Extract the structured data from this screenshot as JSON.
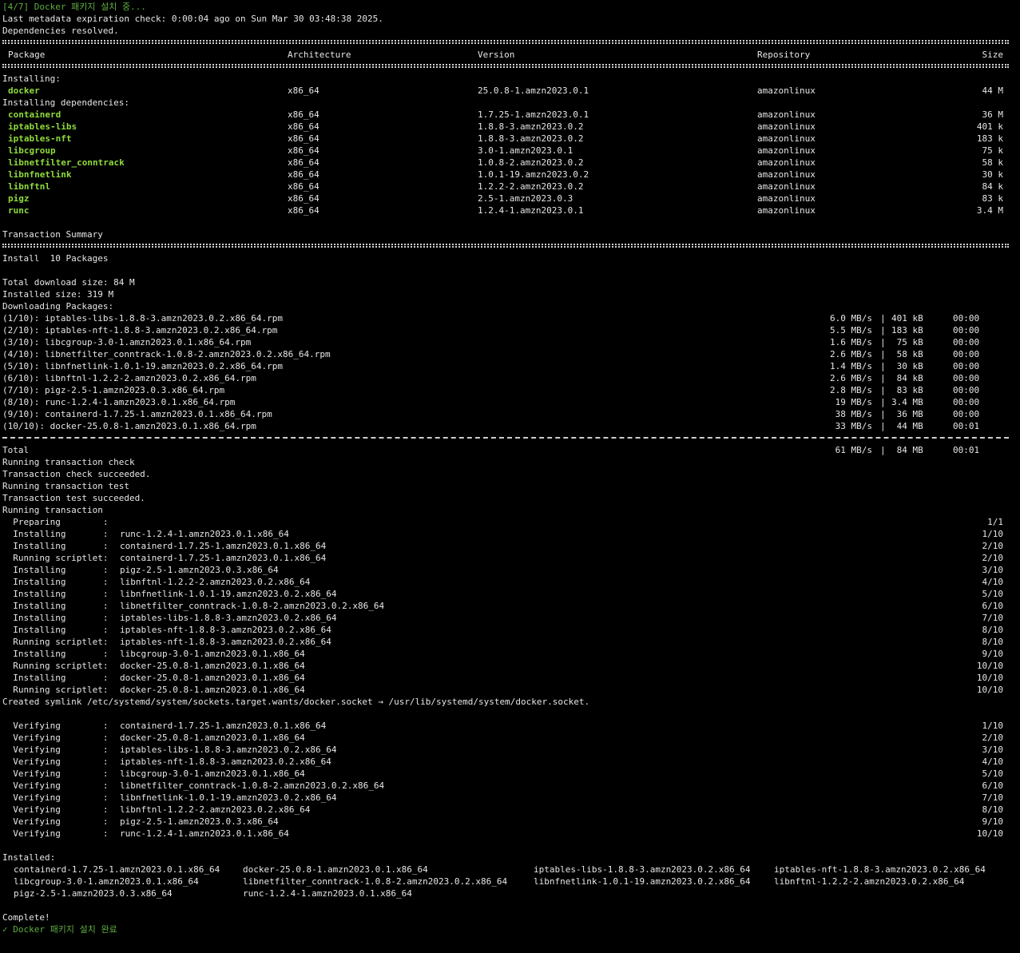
{
  "header": {
    "status_start": "[4/7] Docker 패키지 설치 중...",
    "metadata": "Last metadata expiration check: 0:00:04 ago on Sun Mar 30 03:48:38 2025.",
    "deps_resolved": "Dependencies resolved."
  },
  "table": {
    "columns": [
      "Package",
      "Architecture",
      "Version",
      "Repository",
      "Size"
    ],
    "installing_label": "Installing:",
    "installing": [
      {
        "name": "docker",
        "arch": "x86_64",
        "version": "25.0.8-1.amzn2023.0.1",
        "repo": "amazonlinux",
        "size": "44 M"
      }
    ],
    "deps_label": "Installing dependencies:",
    "deps": [
      {
        "name": "containerd",
        "arch": "x86_64",
        "version": "1.7.25-1.amzn2023.0.1",
        "repo": "amazonlinux",
        "size": "36 M"
      },
      {
        "name": "iptables-libs",
        "arch": "x86_64",
        "version": "1.8.8-3.amzn2023.0.2",
        "repo": "amazonlinux",
        "size": "401 k"
      },
      {
        "name": "iptables-nft",
        "arch": "x86_64",
        "version": "1.8.8-3.amzn2023.0.2",
        "repo": "amazonlinux",
        "size": "183 k"
      },
      {
        "name": "libcgroup",
        "arch": "x86_64",
        "version": "3.0-1.amzn2023.0.1",
        "repo": "amazonlinux",
        "size": "75 k"
      },
      {
        "name": "libnetfilter_conntrack",
        "arch": "x86_64",
        "version": "1.0.8-2.amzn2023.0.2",
        "repo": "amazonlinux",
        "size": "58 k"
      },
      {
        "name": "libnfnetlink",
        "arch": "x86_64",
        "version": "1.0.1-19.amzn2023.0.2",
        "repo": "amazonlinux",
        "size": "30 k"
      },
      {
        "name": "libnftnl",
        "arch": "x86_64",
        "version": "1.2.2-2.amzn2023.0.2",
        "repo": "amazonlinux",
        "size": "84 k"
      },
      {
        "name": "pigz",
        "arch": "x86_64",
        "version": "2.5-1.amzn2023.0.3",
        "repo": "amazonlinux",
        "size": "83 k"
      },
      {
        "name": "runc",
        "arch": "x86_64",
        "version": "1.2.4-1.amzn2023.0.1",
        "repo": "amazonlinux",
        "size": "3.4 M"
      }
    ]
  },
  "summary": {
    "title": "Transaction Summary",
    "install_line": "Install  10 Packages",
    "total_download": "Total download size: 84 M",
    "installed_size": "Installed size: 319 M",
    "downloading": "Downloading Packages:"
  },
  "downloads": [
    {
      "file": "(1/10): iptables-libs-1.8.8-3.amzn2023.0.2.x86_64.rpm",
      "speed": "6.0 MB/s",
      "size": "401 kB",
      "time": "00:00"
    },
    {
      "file": "(2/10): iptables-nft-1.8.8-3.amzn2023.0.2.x86_64.rpm",
      "speed": "5.5 MB/s",
      "size": "183 kB",
      "time": "00:00"
    },
    {
      "file": "(3/10): libcgroup-3.0-1.amzn2023.0.1.x86_64.rpm",
      "speed": "1.6 MB/s",
      "size": " 75 kB",
      "time": "00:00"
    },
    {
      "file": "(4/10): libnetfilter_conntrack-1.0.8-2.amzn2023.0.2.x86_64.rpm",
      "speed": "2.6 MB/s",
      "size": " 58 kB",
      "time": "00:00"
    },
    {
      "file": "(5/10): libnfnetlink-1.0.1-19.amzn2023.0.2.x86_64.rpm",
      "speed": "1.4 MB/s",
      "size": " 30 kB",
      "time": "00:00"
    },
    {
      "file": "(6/10): libnftnl-1.2.2-2.amzn2023.0.2.x86_64.rpm",
      "speed": "2.6 MB/s",
      "size": " 84 kB",
      "time": "00:00"
    },
    {
      "file": "(7/10): pigz-2.5-1.amzn2023.0.3.x86_64.rpm",
      "speed": "2.8 MB/s",
      "size": " 83 kB",
      "time": "00:00"
    },
    {
      "file": "(8/10): runc-1.2.4-1.amzn2023.0.1.x86_64.rpm",
      "speed": " 19 MB/s",
      "size": "3.4 MB",
      "time": "00:00"
    },
    {
      "file": "(9/10): containerd-1.7.25-1.amzn2023.0.1.x86_64.rpm",
      "speed": " 38 MB/s",
      "size": " 36 MB",
      "time": "00:00"
    },
    {
      "file": "(10/10): docker-25.0.8-1.amzn2023.0.1.x86_64.rpm",
      "speed": " 33 MB/s",
      "size": " 44 MB",
      "time": "00:01"
    }
  ],
  "total": {
    "label": "Total",
    "speed": " 61 MB/s",
    "size": " 84 MB",
    "time": "00:01"
  },
  "transaction_lines": [
    "Running transaction check",
    "Transaction check succeeded.",
    "Running transaction test",
    "Transaction test succeeded.",
    "Running transaction"
  ],
  "steps": [
    {
      "action": "  Preparing        :",
      "target": "",
      "count": "1/1"
    },
    {
      "action": "  Installing       :",
      "target": "runc-1.2.4-1.amzn2023.0.1.x86_64",
      "count": "1/10"
    },
    {
      "action": "  Installing       :",
      "target": "containerd-1.7.25-1.amzn2023.0.1.x86_64",
      "count": "2/10"
    },
    {
      "action": "  Running scriptlet:",
      "target": "containerd-1.7.25-1.amzn2023.0.1.x86_64",
      "count": "2/10"
    },
    {
      "action": "  Installing       :",
      "target": "pigz-2.5-1.amzn2023.0.3.x86_64",
      "count": "3/10"
    },
    {
      "action": "  Installing       :",
      "target": "libnftnl-1.2.2-2.amzn2023.0.2.x86_64",
      "count": "4/10"
    },
    {
      "action": "  Installing       :",
      "target": "libnfnetlink-1.0.1-19.amzn2023.0.2.x86_64",
      "count": "5/10"
    },
    {
      "action": "  Installing       :",
      "target": "libnetfilter_conntrack-1.0.8-2.amzn2023.0.2.x86_64",
      "count": "6/10"
    },
    {
      "action": "  Installing       :",
      "target": "iptables-libs-1.8.8-3.amzn2023.0.2.x86_64",
      "count": "7/10"
    },
    {
      "action": "  Installing       :",
      "target": "iptables-nft-1.8.8-3.amzn2023.0.2.x86_64",
      "count": "8/10"
    },
    {
      "action": "  Running scriptlet:",
      "target": "iptables-nft-1.8.8-3.amzn2023.0.2.x86_64",
      "count": "8/10"
    },
    {
      "action": "  Installing       :",
      "target": "libcgroup-3.0-1.amzn2023.0.1.x86_64",
      "count": "9/10"
    },
    {
      "action": "  Running scriptlet:",
      "target": "docker-25.0.8-1.amzn2023.0.1.x86_64",
      "count": "10/10"
    },
    {
      "action": "  Installing       :",
      "target": "docker-25.0.8-1.amzn2023.0.1.x86_64",
      "count": "10/10"
    },
    {
      "action": "  Running scriptlet:",
      "target": "docker-25.0.8-1.amzn2023.0.1.x86_64",
      "count": "10/10"
    }
  ],
  "symlink": "Created symlink /etc/systemd/system/sockets.target.wants/docker.socket → /usr/lib/systemd/system/docker.socket.",
  "verify": [
    {
      "action": "  Verifying        :",
      "target": "containerd-1.7.25-1.amzn2023.0.1.x86_64",
      "count": "1/10"
    },
    {
      "action": "  Verifying        :",
      "target": "docker-25.0.8-1.amzn2023.0.1.x86_64",
      "count": "2/10"
    },
    {
      "action": "  Verifying        :",
      "target": "iptables-libs-1.8.8-3.amzn2023.0.2.x86_64",
      "count": "3/10"
    },
    {
      "action": "  Verifying        :",
      "target": "iptables-nft-1.8.8-3.amzn2023.0.2.x86_64",
      "count": "4/10"
    },
    {
      "action": "  Verifying        :",
      "target": "libcgroup-3.0-1.amzn2023.0.1.x86_64",
      "count": "5/10"
    },
    {
      "action": "  Verifying        :",
      "target": "libnetfilter_conntrack-1.0.8-2.amzn2023.0.2.x86_64",
      "count": "6/10"
    },
    {
      "action": "  Verifying        :",
      "target": "libnfnetlink-1.0.1-19.amzn2023.0.2.x86_64",
      "count": "7/10"
    },
    {
      "action": "  Verifying        :",
      "target": "libnftnl-1.2.2-2.amzn2023.0.2.x86_64",
      "count": "8/10"
    },
    {
      "action": "  Verifying        :",
      "target": "pigz-2.5-1.amzn2023.0.3.x86_64",
      "count": "9/10"
    },
    {
      "action": "  Verifying        :",
      "target": "runc-1.2.4-1.amzn2023.0.1.x86_64",
      "count": "10/10"
    }
  ],
  "installed": {
    "label": "Installed:",
    "rows": [
      [
        "containerd-1.7.25-1.amzn2023.0.1.x86_64",
        "docker-25.0.8-1.amzn2023.0.1.x86_64",
        "iptables-libs-1.8.8-3.amzn2023.0.2.x86_64",
        "iptables-nft-1.8.8-3.amzn2023.0.2.x86_64"
      ],
      [
        "libcgroup-3.0-1.amzn2023.0.1.x86_64",
        "libnetfilter_conntrack-1.0.8-2.amzn2023.0.2.x86_64",
        "libnfnetlink-1.0.1-19.amzn2023.0.2.x86_64",
        "libnftnl-1.2.2-2.amzn2023.0.2.x86_64"
      ],
      [
        "pigz-2.5-1.amzn2023.0.3.x86_64",
        "runc-1.2.4-1.amzn2023.0.1.x86_64",
        "",
        ""
      ]
    ]
  },
  "complete": "Complete!",
  "status_done": "✓ Docker 패키지 설치 완료",
  "colors": {
    "background": "#000000",
    "text": "#e6e6e6",
    "package": "#8fdc3c",
    "status": "#5fae3f"
  }
}
